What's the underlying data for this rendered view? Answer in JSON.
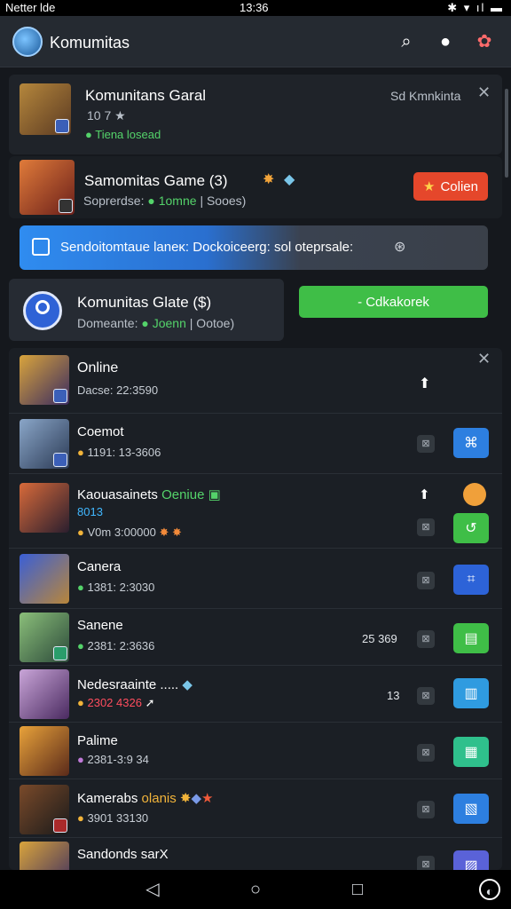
{
  "status": {
    "left": "Netter lde",
    "time": "13:36",
    "right": "✱ ▾ ıl ▬"
  },
  "appbar": {
    "title": "Komumitas"
  },
  "card1": {
    "title": "Komunitans Garal",
    "rating": "10 7",
    "status": "Tiena losead",
    "right_label": "Sd Kmnkinta"
  },
  "card2": {
    "title": "Samomitas Game (3)",
    "meta_prefix": "Soprerdse:",
    "meta_green": "1omne",
    "meta_suffix": "| Sooes)",
    "button": "Colien"
  },
  "banner": {
    "text": "Sendoitomtaue laneκ: Dockoiceerg: sol oteprsale:"
  },
  "card3": {
    "title": "Komunitas Glate ($)",
    "meta_prefix": "Domeante:",
    "meta_green": "Joenn",
    "meta_suffix": "| Ootoe)",
    "button": "- Cdkakorek"
  },
  "list": [
    {
      "name": "Online",
      "meta": "Dacse: 22:3590",
      "num": ""
    },
    {
      "name": "Coemot",
      "meta": "1191: 13-3606",
      "num": ""
    },
    {
      "name": "Kaouasainets",
      "name_green": "Oeniue",
      "extra": "8013",
      "meta": "V0m 3:00000",
      "num": ""
    },
    {
      "name": "Canera",
      "meta": "1381: 2:3030",
      "num": ""
    },
    {
      "name": "Sanene",
      "meta": "2381: 2:3636",
      "num": "25 369"
    },
    {
      "name": "Nedesraainte .....",
      "meta": "2302 4326",
      "num": "13"
    },
    {
      "name": "Palime",
      "meta": "2381-3:9 34",
      "num": ""
    },
    {
      "name": "Kamerabs",
      "name_green": "olanis",
      "meta": "3901 33130",
      "num": ""
    },
    {
      "name": "Sandonds sarX",
      "meta": "",
      "num": ""
    }
  ],
  "colors": {
    "accent_green": "#3fbe47",
    "accent_red": "#e5472b",
    "accent_blue": "#2d7fe0"
  }
}
